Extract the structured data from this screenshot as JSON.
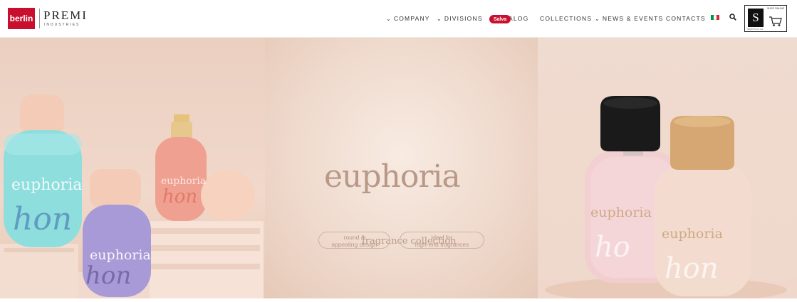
{
  "header": {
    "logo_berlin": "berlin",
    "logo_premi": "PREMI",
    "logo_industries": "INDUSTRIES",
    "nav": [
      {
        "label": "COMPANY",
        "has_dropdown": true
      },
      {
        "label": "DIVISIONS",
        "has_dropdown": true
      },
      {
        "label": "ALOG",
        "has_dropdown": false
      },
      {
        "label": "COLLECTIONS",
        "has_dropdown": false
      },
      {
        "label": "NEWS & EVENTS",
        "has_dropdown": true
      },
      {
        "label": "CONTACTS",
        "has_dropdown": false
      }
    ],
    "pinterest_badge": "Salva",
    "language_flag": "italy-flag-icon",
    "search_icon": "search-icon",
    "shop": {
      "letter": "S",
      "caption": "SHOP ONLINE",
      "footer": "SHOP Premi Ind."
    }
  },
  "hero": {
    "title": "euphoria",
    "subtitle": "fragrance collection",
    "features": [
      {
        "line1": "round &",
        "line2": "appealing design"
      },
      {
        "line1": "ideal for",
        "line2": "high-end fragrances"
      }
    ],
    "bottle_labels": {
      "brand": "euphoria",
      "script": "hon"
    }
  },
  "colors": {
    "brand_red": "#c8102e",
    "hero_bg": "#ecd4c6",
    "title_color": "#b89887"
  }
}
